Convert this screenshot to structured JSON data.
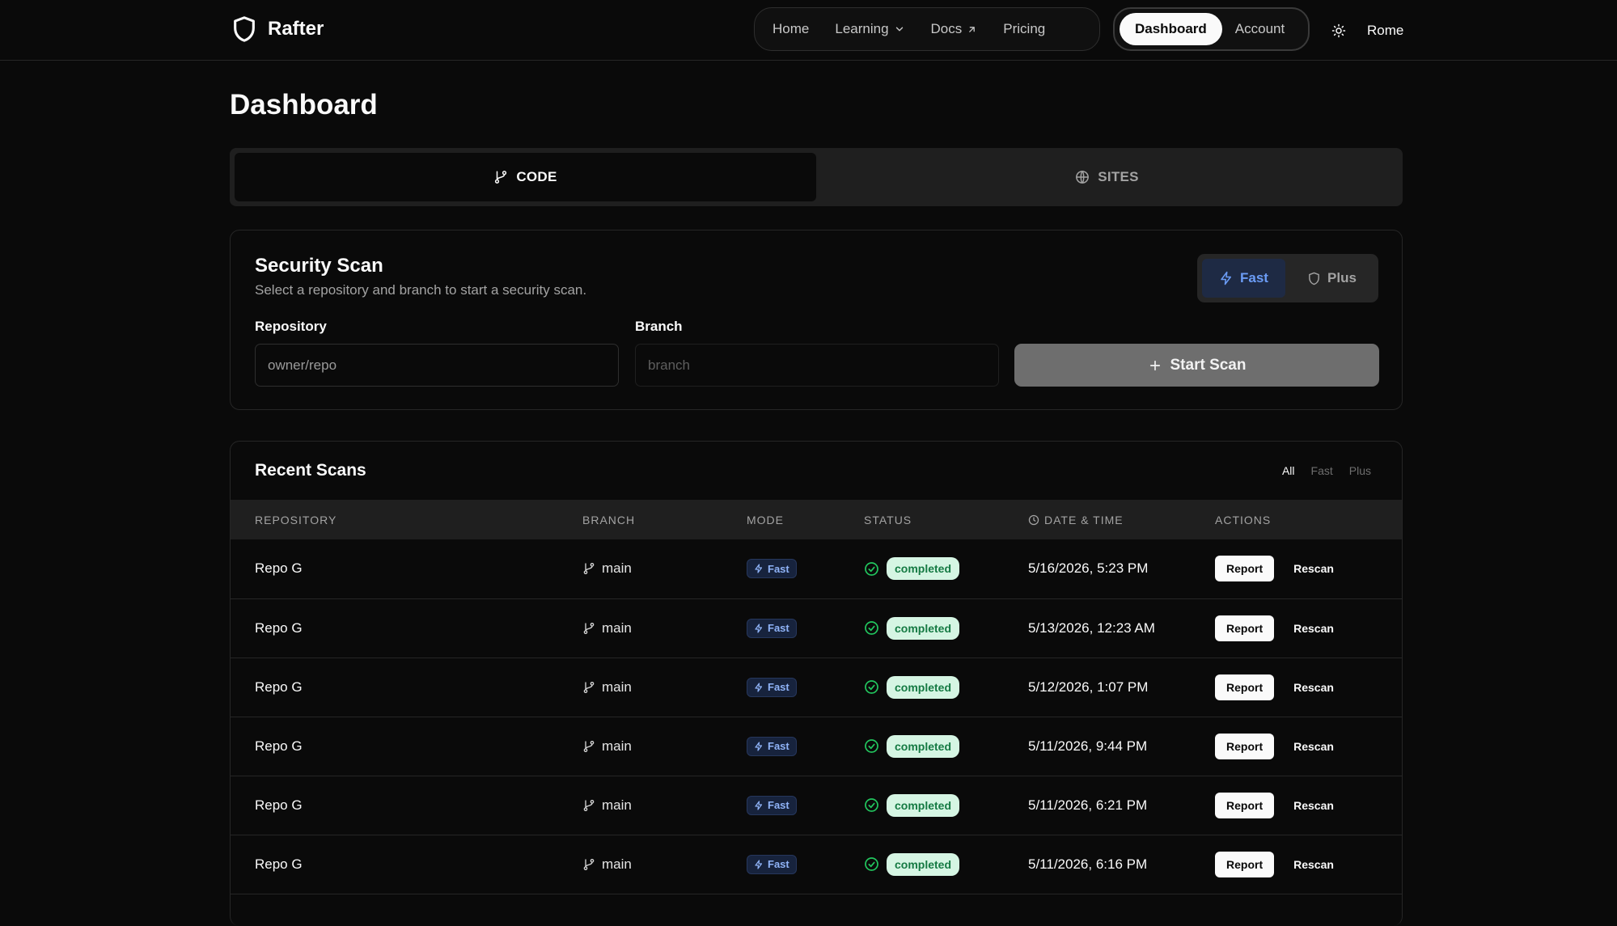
{
  "app": {
    "name": "Rafter"
  },
  "nav": {
    "items": [
      {
        "key": "home",
        "label": "Home"
      },
      {
        "key": "learning",
        "label": "Learning"
      },
      {
        "key": "docs",
        "label": "Docs"
      },
      {
        "key": "pricing",
        "label": "Pricing"
      }
    ],
    "account_items": [
      {
        "key": "dashboard",
        "label": "Dashboard",
        "active": true
      },
      {
        "key": "account",
        "label": "Account",
        "active": false
      }
    ],
    "user_name": "Rome"
  },
  "page": {
    "title": "Dashboard"
  },
  "tabs": [
    {
      "key": "code",
      "label": "CODE",
      "icon": "git-branch-icon",
      "active": true
    },
    {
      "key": "sites",
      "label": "SITES",
      "icon": "globe-icon",
      "active": false
    }
  ],
  "scan": {
    "title": "Security Scan",
    "description": "Select a repository and branch to start a security scan.",
    "modes": [
      {
        "key": "fast",
        "label": "Fast",
        "icon": "zap-icon",
        "active": true
      },
      {
        "key": "plus",
        "label": "Plus",
        "icon": "shield-icon",
        "active": false
      }
    ],
    "repository": {
      "label": "Repository",
      "value": "",
      "placeholder": "owner/repo"
    },
    "branch": {
      "label": "Branch",
      "value": "",
      "placeholder": "branch"
    },
    "start_label": "Start Scan"
  },
  "recent": {
    "title": "Recent Scans",
    "filters": [
      {
        "key": "all",
        "label": "All",
        "active": true
      },
      {
        "key": "fast",
        "label": "Fast",
        "active": false
      },
      {
        "key": "plus",
        "label": "Plus",
        "active": false
      }
    ],
    "columns": {
      "repository": "REPOSITORY",
      "branch": "BRANCH",
      "mode": "MODE",
      "status": "STATUS",
      "date": "DATE & TIME",
      "actions": "ACTIONS"
    },
    "report_label": "Report",
    "rescan_label": "Rescan",
    "rows": [
      {
        "repo": "Repo G",
        "branch": "main",
        "mode": "Fast",
        "status": "completed",
        "date": "5/16/2026, 5:23 PM"
      },
      {
        "repo": "Repo G",
        "branch": "main",
        "mode": "Fast",
        "status": "completed",
        "date": "5/13/2026, 12:23 AM"
      },
      {
        "repo": "Repo G",
        "branch": "main",
        "mode": "Fast",
        "status": "completed",
        "date": "5/12/2026, 1:07 PM"
      },
      {
        "repo": "Repo G",
        "branch": "main",
        "mode": "Fast",
        "status": "completed",
        "date": "5/11/2026, 9:44 PM"
      },
      {
        "repo": "Repo G",
        "branch": "main",
        "mode": "Fast",
        "status": "completed",
        "date": "5/11/2026, 6:21 PM"
      },
      {
        "repo": "Repo G",
        "branch": "main",
        "mode": "Fast",
        "status": "completed",
        "date": "5/11/2026, 6:16 PM"
      }
    ]
  },
  "colors": {
    "background": "#0a0a0a",
    "accent_blue": "#6b9cf5",
    "status_green": "#22c55e",
    "status_badge_bg": "#d5f5e3"
  }
}
